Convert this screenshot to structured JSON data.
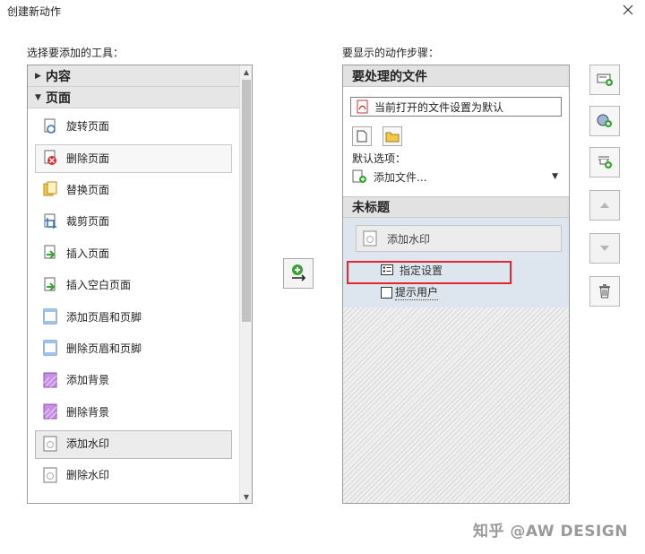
{
  "window": {
    "title": "创建新动作"
  },
  "left": {
    "label": "选择要添加的工具：",
    "groups": [
      {
        "label": "内容",
        "expanded": false
      },
      {
        "label": "页面",
        "expanded": true
      }
    ],
    "tools": [
      {
        "label": "旋转页面",
        "icon": "rotate-page-icon"
      },
      {
        "label": "删除页面",
        "icon": "delete-page-icon"
      },
      {
        "label": "替换页面",
        "icon": "replace-page-icon"
      },
      {
        "label": "裁剪页面",
        "icon": "crop-page-icon"
      },
      {
        "label": "插入页面",
        "icon": "insert-page-icon"
      },
      {
        "label": "插入空白页面",
        "icon": "insert-blank-page-icon"
      },
      {
        "label": "添加页眉和页脚",
        "icon": "add-header-footer-icon"
      },
      {
        "label": "删除页眉和页脚",
        "icon": "remove-header-footer-icon"
      },
      {
        "label": "添加背景",
        "icon": "add-background-icon"
      },
      {
        "label": "删除背景",
        "icon": "remove-background-icon"
      },
      {
        "label": "添加水印",
        "icon": "add-watermark-icon"
      },
      {
        "label": "删除水印",
        "icon": "remove-watermark-icon"
      }
    ]
  },
  "right": {
    "label": "要显示的动作步骤：",
    "files_header": "要处理的文件",
    "file_value": "当前打开的文件设置为默认",
    "default_options_label": "默认选项：",
    "add_file_value": "添加文件...",
    "untitled_header": "未标题",
    "step_label": "添加水印",
    "specify_settings": "指定设置",
    "prompt_user": "提示用户"
  },
  "watermark": "知乎 @AW DESIGN",
  "colors": {
    "highlight": "#e3262f",
    "accent_green": "#3aa335"
  }
}
